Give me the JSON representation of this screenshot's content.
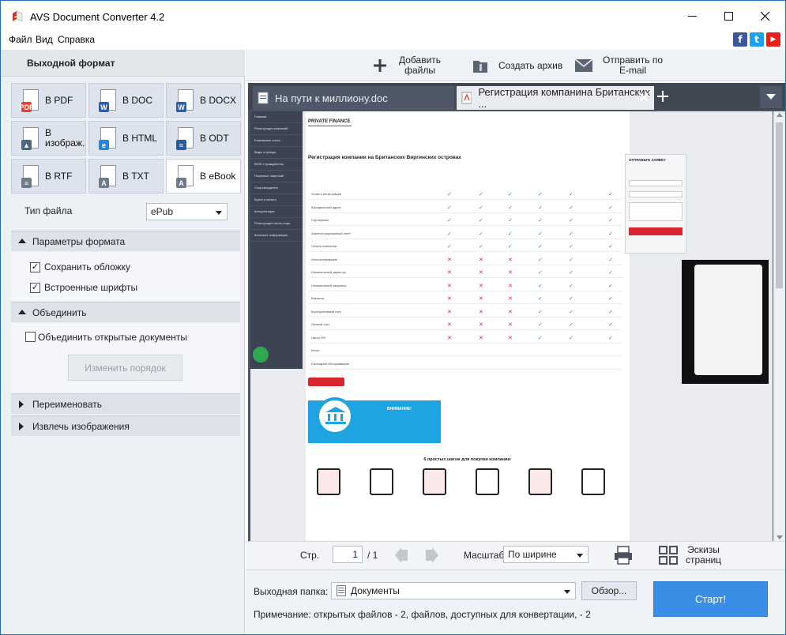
{
  "window": {
    "title": "AVS Document Converter 4.2",
    "controls": [
      "—",
      "☐",
      "✕"
    ]
  },
  "menu": [
    "Файл",
    "Вид",
    "Справка"
  ],
  "social": [
    {
      "icon": "facebook-icon",
      "glyph": "f",
      "color": "#3b5998"
    },
    {
      "icon": "twitter-icon",
      "glyph": "t",
      "color": "#1da1f2"
    },
    {
      "icon": "youtube-icon",
      "glyph": "▶",
      "color": "#e62117"
    }
  ],
  "left": {
    "header": "Выходной формат",
    "formats": [
      {
        "label": "В PDF",
        "badge": "PDF",
        "color": "#e8402e",
        "active": false
      },
      {
        "label": "В DOC",
        "badge": "W",
        "color": "#2b5fb3",
        "active": false
      },
      {
        "label": "В DOCX",
        "badge": "W",
        "color": "#2b5fb3",
        "active": false
      },
      {
        "label": "В\nизображ.",
        "badge": "▲",
        "color": "#4a6785",
        "active": false
      },
      {
        "label": "В HTML",
        "badge": "e",
        "color": "#1e88e5",
        "active": false
      },
      {
        "label": "В ODT",
        "badge": "≈",
        "color": "#2a5d9f",
        "active": false
      },
      {
        "label": "В RTF",
        "badge": "≡",
        "color": "#6b7a8c",
        "active": false
      },
      {
        "label": "В TXT",
        "badge": "A",
        "color": "#6b7a8c",
        "active": false
      },
      {
        "label": "В eBook",
        "badge": "A",
        "color": "#6b7a8c",
        "active": true
      }
    ],
    "file_type_label": "Тип файла",
    "file_type_value": "ePub",
    "format_params": "Параметры формата",
    "save_cover": "Сохранить обложку",
    "embed_fonts": "Встроенные шрифты",
    "merge": "Объединить",
    "merge_docs": "Объединить открытые документы",
    "change_order": "Изменить порядок",
    "rename": "Переименовать",
    "extract_images": "Извлечь изображения"
  },
  "toolbar": {
    "add_files": "Добавить\nфайлы",
    "create_archive": "Создать архив",
    "send_email": "Отправить по\nE-mail"
  },
  "tabs": [
    {
      "label": "На пути к миллиону.doc",
      "active": false
    },
    {
      "label": "Регистрация компанина Британских ...",
      "active": true
    }
  ],
  "pager": {
    "page_label": "Стр.",
    "page_value": "1",
    "page_total": "/ 1",
    "zoom_label": "Масштаб",
    "zoom_value": "По ширине",
    "thumbs": "Эскизы\nстраниц"
  },
  "output": {
    "folder_label": "Выходная папка:",
    "folder_value": "Документы",
    "browse": "Обзор...",
    "start": "Старт!",
    "note": "Примечание: открытых файлов - 2, файлов, доступных для конвертации, - 2"
  },
  "site": {
    "brand": "PRIVATE FINANCE",
    "heading": "Регистрация компании на Британских Виргинских островах",
    "form_title": "ОТПРАВЬТЕ ЗАЯВКУ",
    "attention": "ВНИМАНИЕ!",
    "steps_title": "6 простых шагов для покупки компании:",
    "nav": [
      "Главная",
      "Регистрация компаний",
      "Банковские счета",
      "Виды в фонды",
      "ВНЖ и гражданство",
      "Покупные лицензий",
      "Сопровождение",
      "Брига и налоги",
      "Консультации",
      "Регистрация ялтиз-лора",
      "Контакты информация"
    ],
    "rows": [
      "Устав и регистрация",
      "Юридический адрес",
      "Сертификат",
      "Зарегистрированный агент",
      "Печать компании",
      "Апостилирование",
      "Номинальный директор",
      "Номинальный акционер",
      "Выписка",
      "Корпоративный счет",
      "Личный счет",
      "Налог 0%",
      "Итого",
      "Ежегодное обслуживание"
    ]
  }
}
